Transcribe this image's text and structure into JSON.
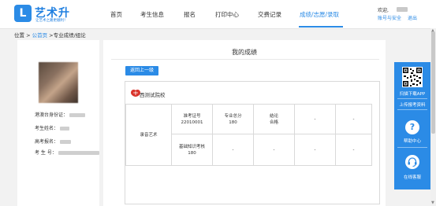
{
  "header": {
    "logo_mark": "L",
    "brand_name": "艺术升",
    "slogan": "让艺术之路更顺利！",
    "nav": [
      "首页",
      "考生信息",
      "报名",
      "打印中心",
      "交费记录",
      "成绩/志愿/录取"
    ],
    "active_nav": "成绩/志愿/录取",
    "welcome": "欢迎,",
    "account_link": "账号与安全",
    "logout": "退出"
  },
  "breadcrumb": {
    "prefix": "位置 > ",
    "home": "公首页",
    "current": " >专业成绩/组论"
  },
  "profile": {
    "id_label": "港澳台身份证：",
    "name_label": "考生姓名：",
    "exam_no_label": "高考报名：",
    "student_no_label": "考 生 号："
  },
  "main": {
    "title": "我的成绩",
    "back_button": "返回上一级",
    "school_name": "西测试院校",
    "table": {
      "row_label": "录音艺术",
      "cells": [
        {
          "label": "准考证号",
          "value": "22010001"
        },
        {
          "label": "专业总分",
          "value": "180"
        },
        {
          "label": "结论",
          "value": "合格"
        },
        {
          "label": "-",
          "value": ""
        },
        {
          "label": "-",
          "value": ""
        },
        {
          "label": "基础知识考核",
          "value": "180"
        },
        {
          "label": "-",
          "value": ""
        },
        {
          "label": "-",
          "value": ""
        },
        {
          "label": "-",
          "value": ""
        },
        {
          "label": "-",
          "value": ""
        }
      ]
    }
  },
  "sidebar": {
    "scan_app": "扫描下载APP",
    "upload": "上传报考资料",
    "help": "帮助中心",
    "service": "在线客服"
  },
  "colors": {
    "accent": "#2b8be6",
    "seal_red": "#d9342b"
  }
}
